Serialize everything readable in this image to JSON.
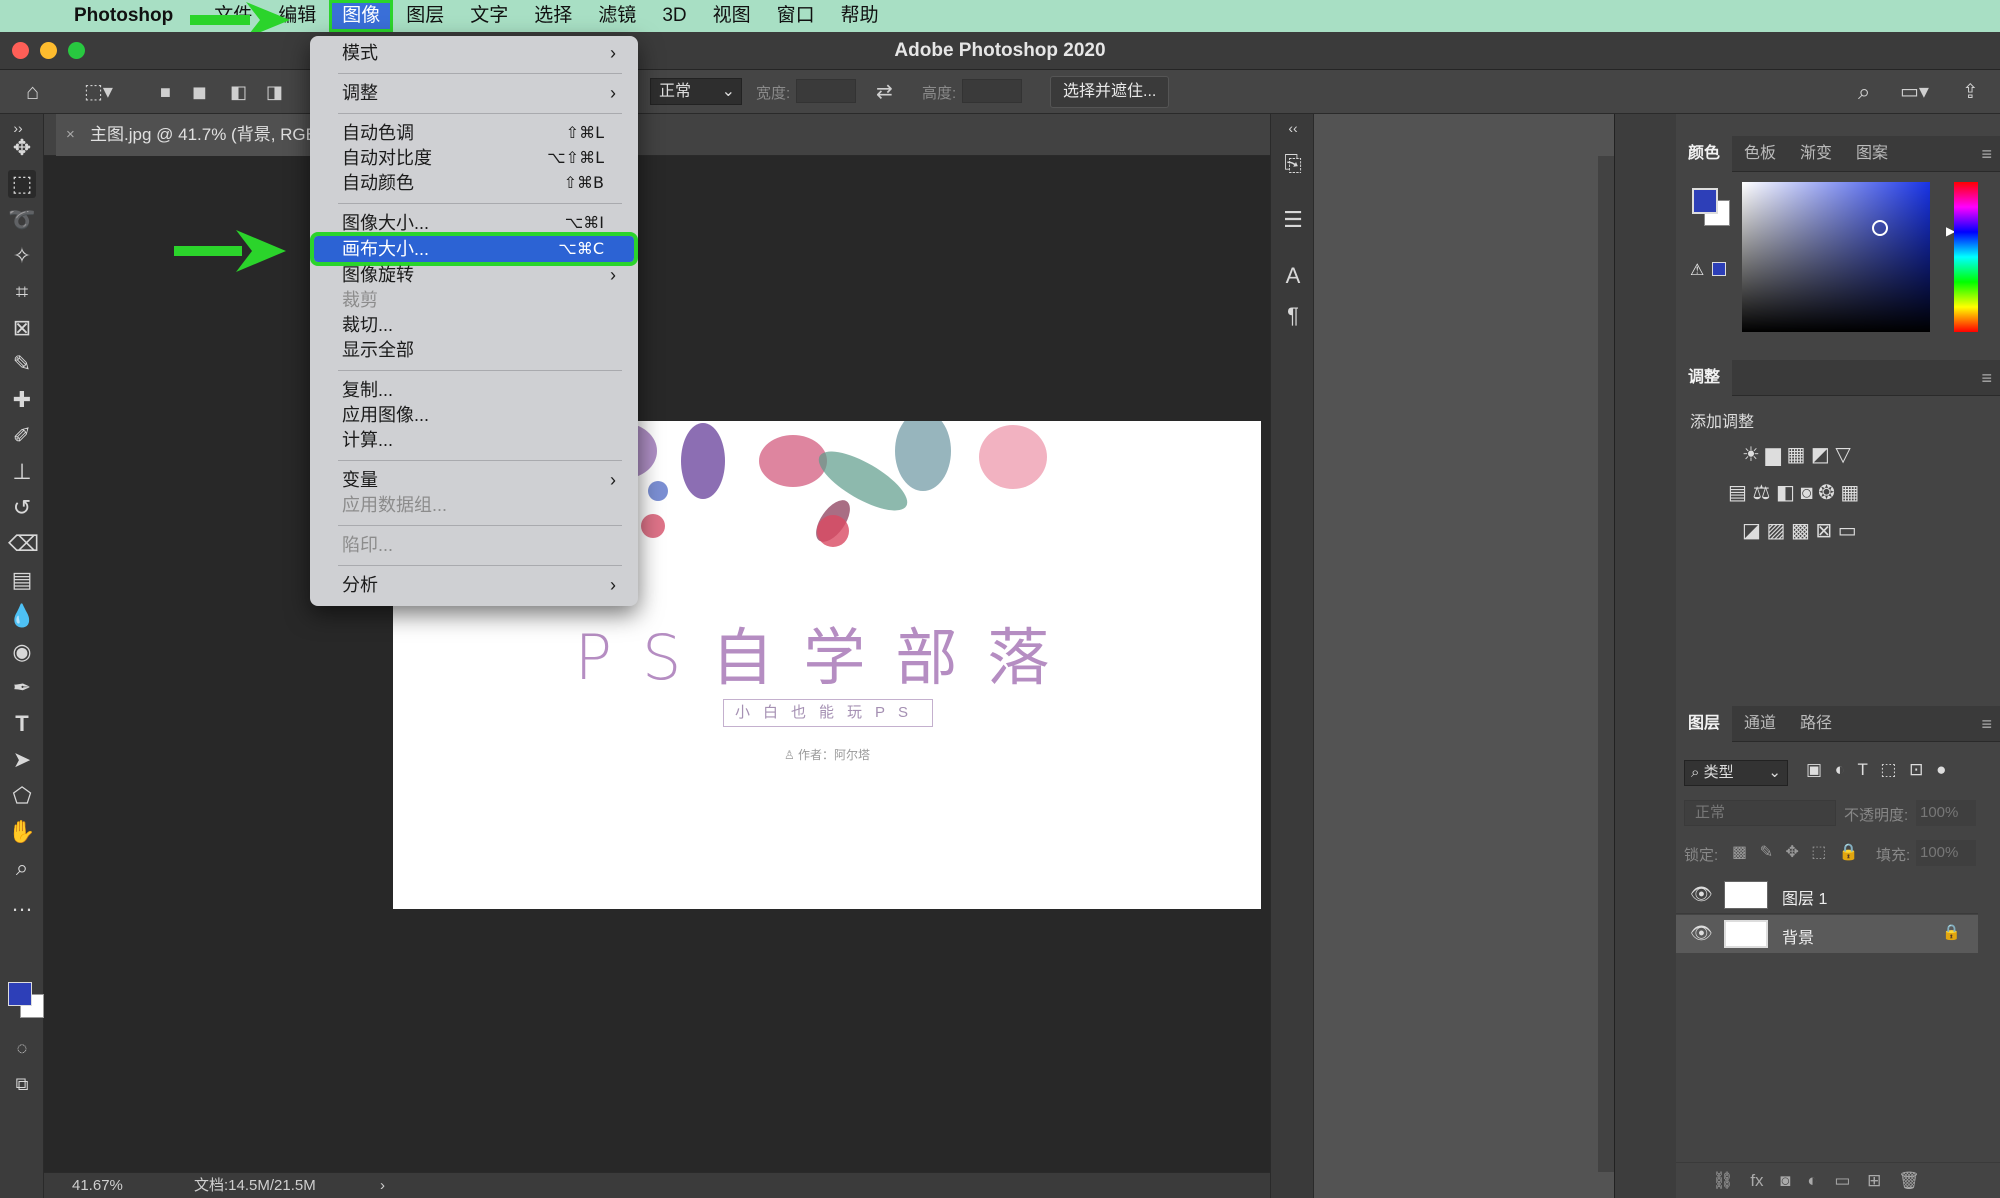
{
  "menubar": {
    "app": "Photoshop",
    "items": [
      "文件",
      "编辑",
      "图像",
      "图层",
      "文字",
      "选择",
      "滤镜",
      "3D",
      "视图",
      "窗口",
      "帮助"
    ]
  },
  "window": {
    "title": "Adobe Photoshop 2020"
  },
  "options": {
    "style_value": "正常",
    "width_label": "宽度:",
    "height_label": "高度:",
    "select_mask_label": "选择并遮住..."
  },
  "doc_tab": {
    "label": "主图.jpg @ 41.7% (背景, RGB/8)"
  },
  "image_menu": {
    "items": [
      {
        "label": "模式",
        "shortcut": "",
        "submenu": true,
        "disabled": false
      },
      {
        "label": "调整",
        "shortcut": "",
        "submenu": true,
        "disabled": false
      },
      {
        "label": "自动色调",
        "shortcut": "⇧⌘L",
        "submenu": false,
        "disabled": false
      },
      {
        "label": "自动对比度",
        "shortcut": "⌥⇧⌘L",
        "submenu": false,
        "disabled": false
      },
      {
        "label": "自动颜色",
        "shortcut": "⇧⌘B",
        "submenu": false,
        "disabled": false
      },
      {
        "label": "图像大小...",
        "shortcut": "⌥⌘I",
        "submenu": false,
        "disabled": false
      },
      {
        "label": "画布大小...",
        "shortcut": "⌥⌘C",
        "submenu": false,
        "disabled": false,
        "highlighted": true
      },
      {
        "label": "图像旋转",
        "shortcut": "",
        "submenu": true,
        "disabled": false
      },
      {
        "label": "裁剪",
        "shortcut": "",
        "submenu": false,
        "disabled": true
      },
      {
        "label": "裁切...",
        "shortcut": "",
        "submenu": false,
        "disabled": false
      },
      {
        "label": "显示全部",
        "shortcut": "",
        "submenu": false,
        "disabled": false
      },
      {
        "label": "复制...",
        "shortcut": "",
        "submenu": false,
        "disabled": false
      },
      {
        "label": "应用图像...",
        "shortcut": "",
        "submenu": false,
        "disabled": false
      },
      {
        "label": "计算...",
        "shortcut": "",
        "submenu": false,
        "disabled": false
      },
      {
        "label": "变量",
        "shortcut": "",
        "submenu": true,
        "disabled": false
      },
      {
        "label": "应用数据组...",
        "shortcut": "",
        "submenu": false,
        "disabled": true
      },
      {
        "label": "陷印...",
        "shortcut": "",
        "submenu": false,
        "disabled": true
      },
      {
        "label": "分析",
        "shortcut": "",
        "submenu": true,
        "disabled": false
      }
    ]
  },
  "canvas_content": {
    "headline": "PS自学部落",
    "subtitle": "小白也能玩PS",
    "author": "作者：阿尔塔"
  },
  "status": {
    "zoom": "41.67%",
    "doc_size": "文档:14.5M/21.5M"
  },
  "color_panel": {
    "tabs": [
      "颜色",
      "色板",
      "渐变",
      "图案"
    ],
    "foreground": "#2d3fb8",
    "background": "#ffffff"
  },
  "adjust_panel": {
    "tab": "调整",
    "heading": "添加调整"
  },
  "layers_panel": {
    "tabs": [
      "图层",
      "通道",
      "路径"
    ],
    "filter_label": "类型",
    "blend_mode": "正常",
    "opacity_label": "不透明度:",
    "opacity_value": "100%",
    "lock_label": "锁定:",
    "fill_label": "填充:",
    "fill_value": "100%",
    "layers": [
      {
        "name": "图层 1",
        "locked": false
      },
      {
        "name": "背景",
        "locked": true
      }
    ]
  },
  "colors": {
    "highlight_outline": "#2bd42b",
    "menu_highlight": "#2c63d4",
    "menubar_bg": "#a8dfc4"
  },
  "icons": [
    "apple-icon",
    "home-icon",
    "marquee-icon",
    "move-icon",
    "crop-icon",
    "eyedropper-icon",
    "brush-icon",
    "text-icon",
    "hand-icon",
    "zoom-icon",
    "eye-icon",
    "lock-icon",
    "search-icon"
  ]
}
